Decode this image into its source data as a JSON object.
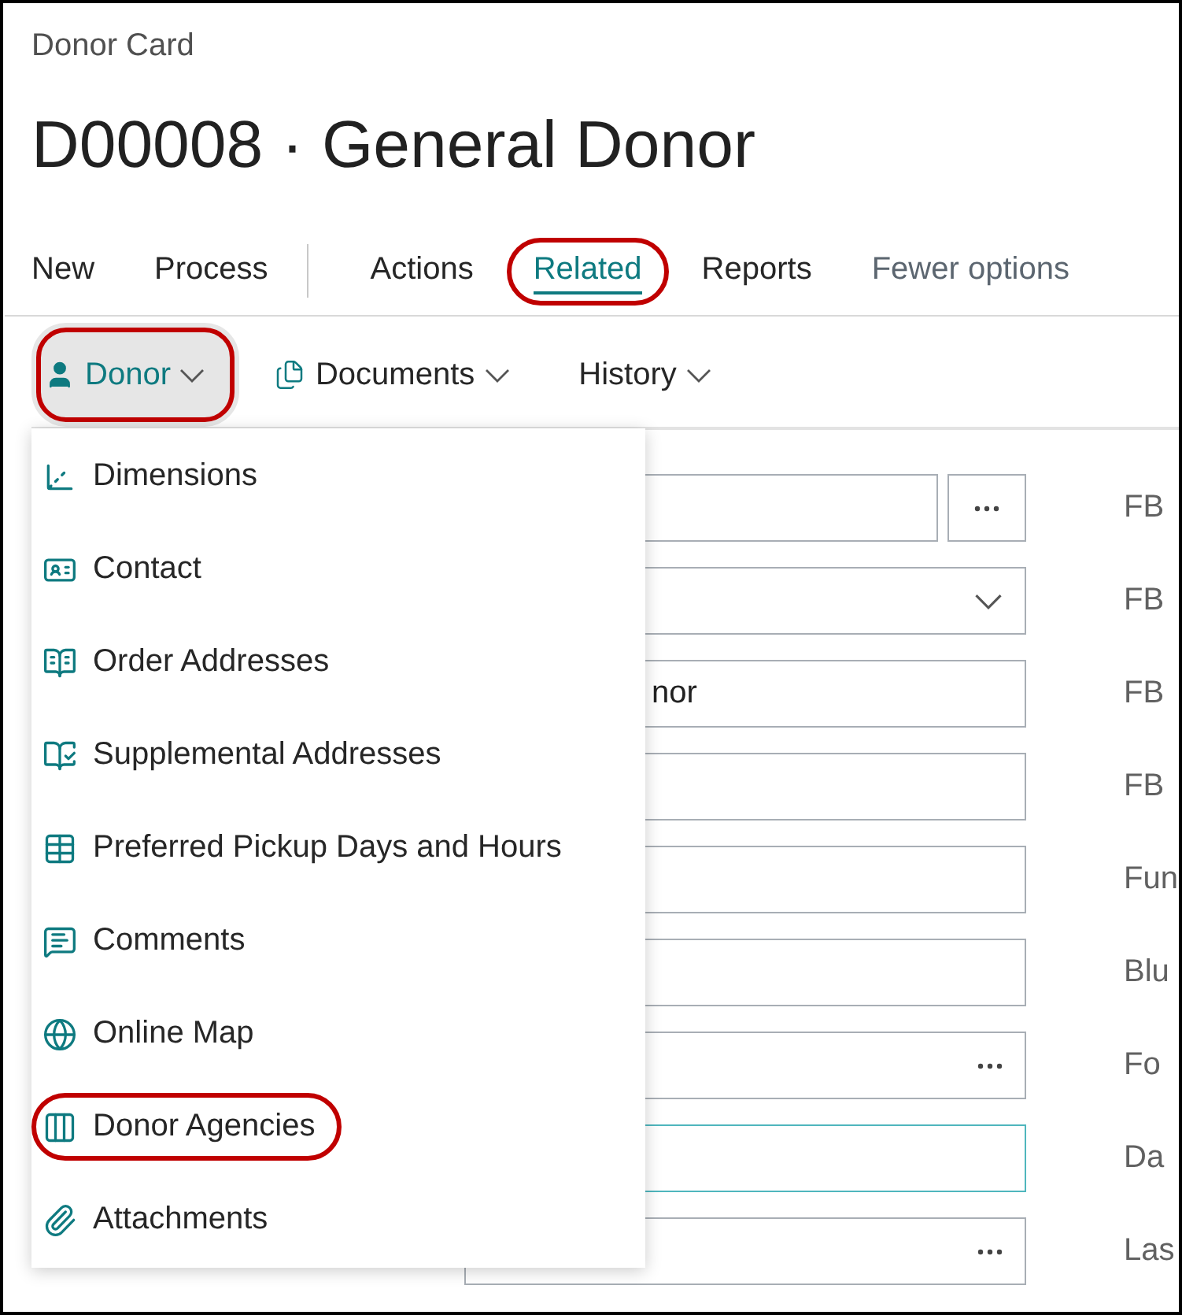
{
  "breadcrumb": "Donor Card",
  "title": "D00008 · General Donor",
  "action_tabs": [
    {
      "label": "New",
      "kind": "tab",
      "selected": false,
      "annotated": false
    },
    {
      "label": "Process",
      "kind": "tab",
      "selected": false,
      "annotated": false
    },
    {
      "kind": "separator"
    },
    {
      "label": "Actions",
      "kind": "tab",
      "selected": false,
      "annotated": false
    },
    {
      "label": "Related",
      "kind": "tab",
      "selected": true,
      "annotated": true
    },
    {
      "label": "Reports",
      "kind": "tab",
      "selected": false,
      "annotated": false
    },
    {
      "label": "Fewer options",
      "kind": "toggle",
      "selected": false,
      "annotated": false
    }
  ],
  "sub_actions": [
    {
      "label": "Donor",
      "selected": true,
      "annotated": true
    },
    {
      "label": "Documents",
      "selected": false,
      "annotated": false
    },
    {
      "label": "History",
      "selected": false,
      "annotated": false
    }
  ],
  "menu": {
    "items": [
      {
        "label": "Dimensions",
        "annotated": false
      },
      {
        "label": "Contact",
        "annotated": false
      },
      {
        "label": "Order Addresses",
        "annotated": false
      },
      {
        "label": "Supplemental Addresses",
        "annotated": false
      },
      {
        "label": "Preferred Pickup Days and Hours",
        "annotated": false
      },
      {
        "label": "Comments",
        "annotated": false
      },
      {
        "label": "Online Map",
        "annotated": false
      },
      {
        "label": "Donor Agencies",
        "annotated": true
      },
      {
        "label": "Attachments",
        "annotated": false
      }
    ]
  },
  "fields": [
    {
      "kind": "lookup-button",
      "focused": false,
      "side_label": "FB"
    },
    {
      "kind": "dropdown",
      "focused": false,
      "side_label": "FB"
    },
    {
      "kind": "text",
      "value": "nor",
      "focused": false,
      "side_label": "FB"
    },
    {
      "kind": "text",
      "focused": false,
      "side_label": "FB"
    },
    {
      "kind": "text",
      "focused": false,
      "side_label": "Fun"
    },
    {
      "kind": "text",
      "focused": false,
      "side_label": "Blu"
    },
    {
      "kind": "lookup",
      "focused": false,
      "side_label": "Fo"
    },
    {
      "kind": "text",
      "focused": true,
      "side_label": "Da"
    },
    {
      "kind": "lookup",
      "focused": false,
      "side_label": "Las"
    }
  ]
}
